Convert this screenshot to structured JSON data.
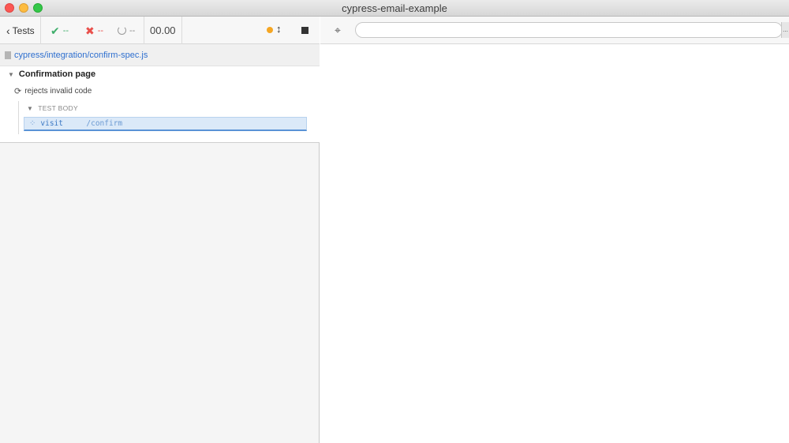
{
  "window": {
    "title": "cypress-email-example"
  },
  "reporter": {
    "tests_button_label": "Tests",
    "stats": {
      "passed": "--",
      "failed": "--",
      "pending": "--"
    },
    "duration": "00.00",
    "status_color": "#f5a623",
    "spec_path": "cypress/integration/confirm-spec.js",
    "suite": {
      "title": "Confirmation page",
      "test": {
        "title": "rejects invalid code",
        "hook_label": "TEST BODY",
        "commands": [
          {
            "name": "visit",
            "message": "/confirm"
          }
        ]
      }
    }
  },
  "aut": {
    "url_value": "",
    "more_label": "..."
  },
  "icons": {
    "back": "chevron-left-icon",
    "pass": "check-icon",
    "fail": "x-icon",
    "pending": "circle-notch-icon",
    "scroll": "arrows-v-icon",
    "stop": "stop-icon",
    "file": "file-icon",
    "refresh": "refresh-icon",
    "spinner": "spinner-icon",
    "selector": "crosshairs-icon"
  }
}
